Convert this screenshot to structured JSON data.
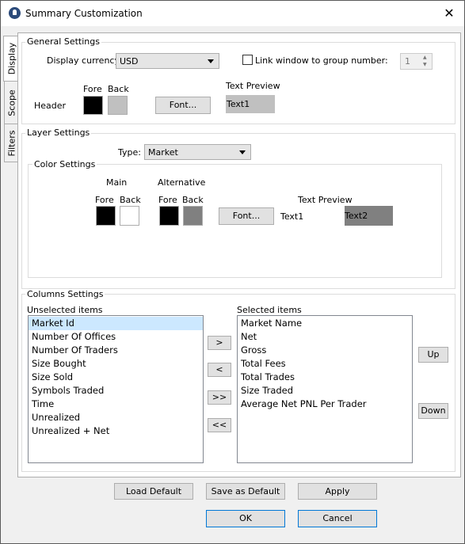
{
  "window": {
    "title": "Summary Customization",
    "close": "✕"
  },
  "tabs": [
    "Display",
    "Scope",
    "Filters"
  ],
  "general": {
    "title": "General Settings",
    "currency_label": "Display currency:",
    "currency_value": "USD",
    "link_label": "Link window to group number:",
    "link_checked": false,
    "group_number": "1",
    "fore_label": "Fore",
    "back_label": "Back",
    "header_label": "Header",
    "font_button": "Font...",
    "preview_label": "Text Preview",
    "preview_text": "Text1",
    "colors": {
      "fore": "#000000",
      "back": "#c0c0c0",
      "preview_bg": "#c0c0c0"
    }
  },
  "layer": {
    "title": "Layer Settings",
    "type_label": "Type:",
    "type_value": "Market",
    "color_settings_title": "Color Settings",
    "main_label": "Main",
    "alt_label": "Alternative",
    "fore_label": "Fore",
    "back_label": "Back",
    "font_button": "Font...",
    "preview_label": "Text Preview",
    "preview_text1": "Text1",
    "preview_text2": "Text2",
    "colors": {
      "main_fore": "#000000",
      "main_back": "#ffffff",
      "alt_fore": "#000000",
      "alt_back": "#808080"
    }
  },
  "columns": {
    "title": "Columns Settings",
    "unselected_label": "Unselected items",
    "selected_label": "Selected items",
    "unselected": [
      "Market Id",
      "Number Of Offices",
      "Number Of Traders",
      "Size Bought",
      "Size Sold",
      "Symbols Traded",
      "Time",
      "Unrealized",
      "Unrealized + Net"
    ],
    "selected": [
      "Market Name",
      "Net",
      "Gross",
      "Total Fees",
      "Total Trades",
      "Size Traded",
      "Average Net PNL Per Trader"
    ],
    "move_right": ">",
    "move_left": "<",
    "move_all_right": ">>",
    "move_all_left": "<<",
    "up": "Up",
    "down": "Down"
  },
  "footer": {
    "load_default": "Load Default",
    "save_default": "Save as Default",
    "apply": "Apply",
    "ok": "OK",
    "cancel": "Cancel"
  }
}
